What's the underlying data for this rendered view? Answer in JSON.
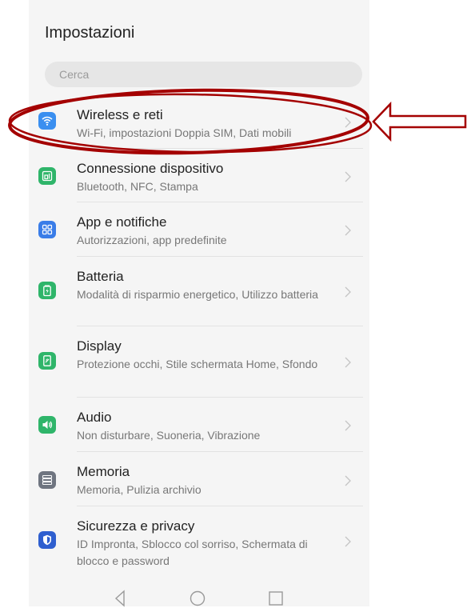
{
  "header": {
    "title": "Impostazioni"
  },
  "search": {
    "placeholder": "Cerca"
  },
  "items": [
    {
      "label": "Wireless e reti",
      "desc": "Wi-Fi, impostazioni Doppia SIM, Dati mobili",
      "icon": "wifi-icon",
      "color": "#3a8ff0"
    },
    {
      "label": "Connessione dispositivo",
      "desc": "Bluetooth, NFC, Stampa",
      "icon": "device-connection-icon",
      "color": "#2fb56a"
    },
    {
      "label": "App e notifiche",
      "desc": "Autorizzazioni, app predefinite",
      "icon": "apps-grid-icon",
      "color": "#3a7de8"
    },
    {
      "label": "Batteria",
      "desc": "Modalità di risparmio energetico, Utilizzo batteria",
      "icon": "battery-icon",
      "color": "#2fb56a"
    },
    {
      "label": "Display",
      "desc": "Protezione occhi, Stile schermata Home, Sfondo",
      "icon": "display-icon",
      "color": "#2fb56a"
    },
    {
      "label": "Audio",
      "desc": "Non disturbare, Suoneria, Vibrazione",
      "icon": "speaker-icon",
      "color": "#2fb56a"
    },
    {
      "label": "Memoria",
      "desc": "Memoria, Pulizia archivio",
      "icon": "storage-icon",
      "color": "#6f7580"
    },
    {
      "label": "Sicurezza e privacy",
      "desc": "ID Impronta, Sblocco col sorriso, Schermata di blocco e password",
      "icon": "shield-icon",
      "color": "#2f5fcf"
    }
  ],
  "navbar": {
    "back": "back-icon",
    "home": "home-icon",
    "recents": "recents-icon"
  },
  "annotation": {
    "highlight_color": "#a40000",
    "arrow": "left-arrow-icon"
  }
}
